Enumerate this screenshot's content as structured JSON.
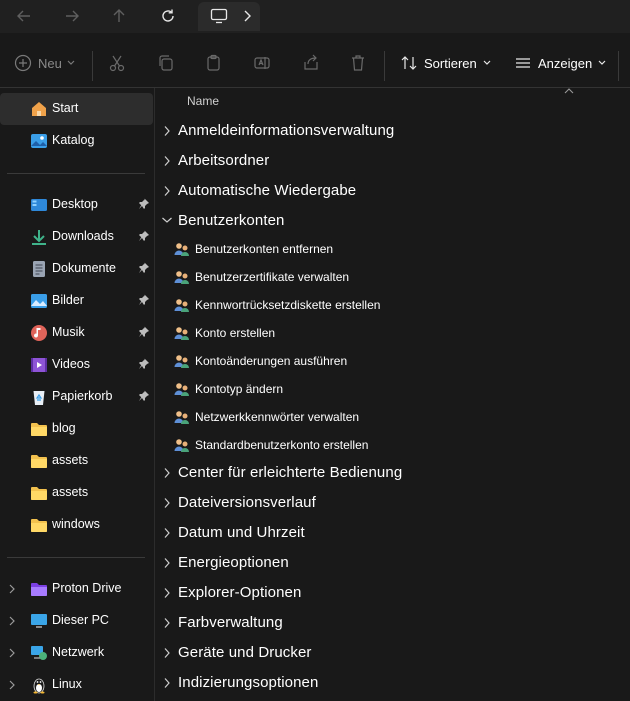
{
  "toolbar": {
    "new_label": "Neu",
    "sort_label": "Sortieren",
    "view_label": "Anzeigen"
  },
  "sidebar": {
    "quick": [
      {
        "label": "Start",
        "icon": "home-icon",
        "selected": true
      },
      {
        "label": "Katalog",
        "icon": "gallery-icon",
        "selected": false
      }
    ],
    "pinned": [
      {
        "label": "Desktop",
        "icon": "desktop-icon",
        "pinned": true
      },
      {
        "label": "Downloads",
        "icon": "download-icon",
        "pinned": true
      },
      {
        "label": "Dokumente",
        "icon": "documents-icon",
        "pinned": true
      },
      {
        "label": "Bilder",
        "icon": "pictures-icon",
        "pinned": true
      },
      {
        "label": "Musik",
        "icon": "music-icon",
        "pinned": true
      },
      {
        "label": "Videos",
        "icon": "videos-icon",
        "pinned": true
      },
      {
        "label": "Papierkorb",
        "icon": "recycle-bin-icon",
        "pinned": true
      },
      {
        "label": "blog",
        "icon": "folder-icon",
        "pinned": false
      },
      {
        "label": "assets",
        "icon": "folder-icon",
        "pinned": false
      },
      {
        "label": "assets",
        "icon": "folder-icon",
        "pinned": false
      },
      {
        "label": "windows",
        "icon": "folder-icon",
        "pinned": false
      }
    ],
    "locations": [
      {
        "label": "Proton Drive",
        "icon": "proton-drive-icon"
      },
      {
        "label": "Dieser PC",
        "icon": "computer-icon"
      },
      {
        "label": "Netzwerk",
        "icon": "network-icon"
      },
      {
        "label": "Linux",
        "icon": "linux-icon"
      }
    ]
  },
  "main": {
    "column_header": "Name",
    "categories_before": [
      "Anmeldeinformationsverwaltung",
      "Arbeitsordner",
      "Automatische Wiedergabe"
    ],
    "expanded_category": "Benutzerkonten",
    "expanded_items": [
      "Benutzerkonten entfernen",
      "Benutzerzertifikate verwalten",
      "Kennwortrücksetzdiskette erstellen",
      "Konto erstellen",
      "Kontoänderungen ausführen",
      "Kontotyp ändern",
      "Netzwerkkennwörter verwalten",
      "Standardbenutzerkonto erstellen"
    ],
    "categories_after": [
      "Center für erleichterte Bedienung",
      "Dateiversionsverlauf",
      "Datum und Uhrzeit",
      "Energieoptionen",
      "Explorer-Optionen",
      "Farbverwaltung",
      "Geräte und Drucker",
      "Indizierungsoptionen"
    ]
  }
}
